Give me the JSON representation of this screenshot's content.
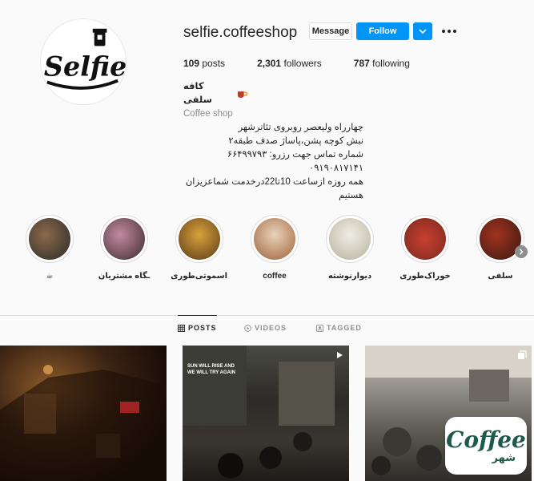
{
  "profile": {
    "username": "selfie.coffeeshop",
    "message_label": "Message",
    "follow_label": "Follow",
    "posts_count": "109",
    "posts_label": "posts",
    "followers_count": "2,301",
    "followers_label": "followers",
    "following_count": "787",
    "following_label": "following",
    "full_name": "کافه سلفی",
    "category": "Coffee shop",
    "bio_lines": [
      "چهارراه ولیعصر روبروی تئاترشهر",
      "نبش کوچه پشن،پاساژ صدف طبقه۲",
      "شماره تماس جهت رزرو: ۶۶۴۹۹۷۹۳",
      "۰۹۱۹۰۸۱۷۱۴۱",
      "همه روزه ازساعت 10تا22درخدمت شماعزیزان",
      "هستیم"
    ],
    "logo_text": "Selfie"
  },
  "highlights": [
    {
      "label": "☕",
      "color_a": "#8b6a4a",
      "color_b": "#2a2a2a"
    },
    {
      "label": "ـگاه مشتریان",
      "color_a": "#c48aa0",
      "color_b": "#3b2a2e"
    },
    {
      "label": "اسموتی‌طوری",
      "color_a": "#d9a23a",
      "color_b": "#5b3a1a"
    },
    {
      "label": "coffee",
      "color_a": "#e7d3b8",
      "color_b": "#a0623a"
    },
    {
      "label": "دیوارنوشته",
      "color_a": "#f0ede4",
      "color_b": "#b7b29f"
    },
    {
      "label": "خوراک‌طوری",
      "color_a": "#c9402f",
      "color_b": "#7a2a20"
    },
    {
      "label": "سلفی",
      "color_a": "#a0321f",
      "color_b": "#3a1a12"
    }
  ],
  "tabs": {
    "posts": "POSTS",
    "videos": "VIDEOS",
    "tagged": "TAGGED"
  },
  "posts": [
    {
      "caption": ""
    },
    {
      "caption": "SUN WILL RISE AND WE WILL TRY AGAIN"
    },
    {
      "caption": ""
    }
  ],
  "watermark": {
    "title": "Coffee",
    "subtitle": "شهر"
  },
  "colors": {
    "accent": "#0095f6",
    "text": "#262626",
    "muted": "#8e8e8e",
    "border": "#dbdbdb",
    "background": "#fafafa",
    "watermark_green": "#1e5a4a"
  }
}
